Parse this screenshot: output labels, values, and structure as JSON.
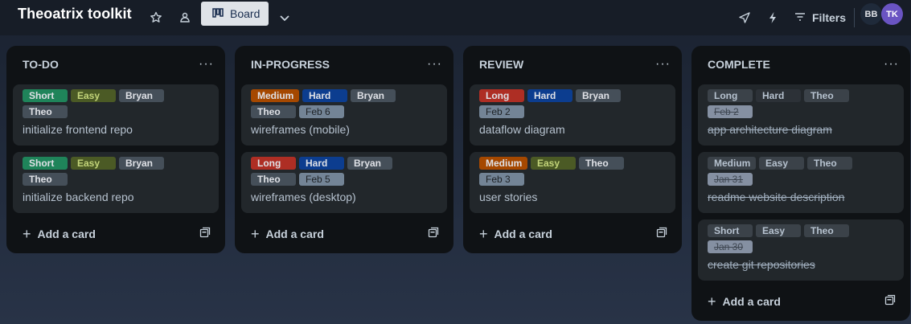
{
  "header": {
    "board_title": "Theoatrix toolkit",
    "view_label": "Board",
    "filters_label": "Filters",
    "avatars": [
      "BB",
      "TK"
    ]
  },
  "colors": {
    "green": "#1f845a",
    "yellow_green": "#4b5a25",
    "neutral": "#454f59",
    "orange": "#a54800",
    "red": "#ae2e24",
    "blue": "#0c3d8f",
    "done_neutral": "#3b4249"
  },
  "lists": [
    {
      "title": "TO-DO",
      "add_label": "Add a card",
      "cards": [
        {
          "labels": [
            "Short",
            "Easy",
            "Bryan",
            "Theo"
          ],
          "title": "initialize frontend repo"
        },
        {
          "labels": [
            "Short",
            "Easy",
            "Bryan",
            "Theo"
          ],
          "title": "initialize backend repo"
        }
      ]
    },
    {
      "title": "IN-PROGRESS",
      "add_label": "Add a card",
      "cards": [
        {
          "labels": [
            "Medium",
            "Hard",
            "Bryan",
            "Theo"
          ],
          "date": "Feb 6",
          "title": "wireframes (mobile)"
        },
        {
          "labels": [
            "Long",
            "Hard",
            "Bryan",
            "Theo"
          ],
          "date": "Feb 5",
          "title": "wireframes (desktop)"
        }
      ]
    },
    {
      "title": "REVIEW",
      "add_label": "Add a card",
      "cards": [
        {
          "labels": [
            "Long",
            "Hard",
            "Bryan"
          ],
          "date": "Feb 2",
          "title": "dataflow diagram"
        },
        {
          "labels": [
            "Medium",
            "Easy",
            "Theo"
          ],
          "date": "Feb 3",
          "title": "user stories"
        }
      ]
    },
    {
      "title": "COMPLETE",
      "add_label": "Add a card",
      "cards": [
        {
          "labels": [
            "Long",
            "Hard",
            "Theo"
          ],
          "date": "Feb 2",
          "title": "app architecture diagram"
        },
        {
          "labels": [
            "Medium",
            "Easy",
            "Theo"
          ],
          "date": "Jan 31",
          "title": "readme website description"
        },
        {
          "labels": [
            "Short",
            "Easy",
            "Theo"
          ],
          "date": "Jan 30",
          "title": "create git repositories"
        }
      ]
    }
  ]
}
